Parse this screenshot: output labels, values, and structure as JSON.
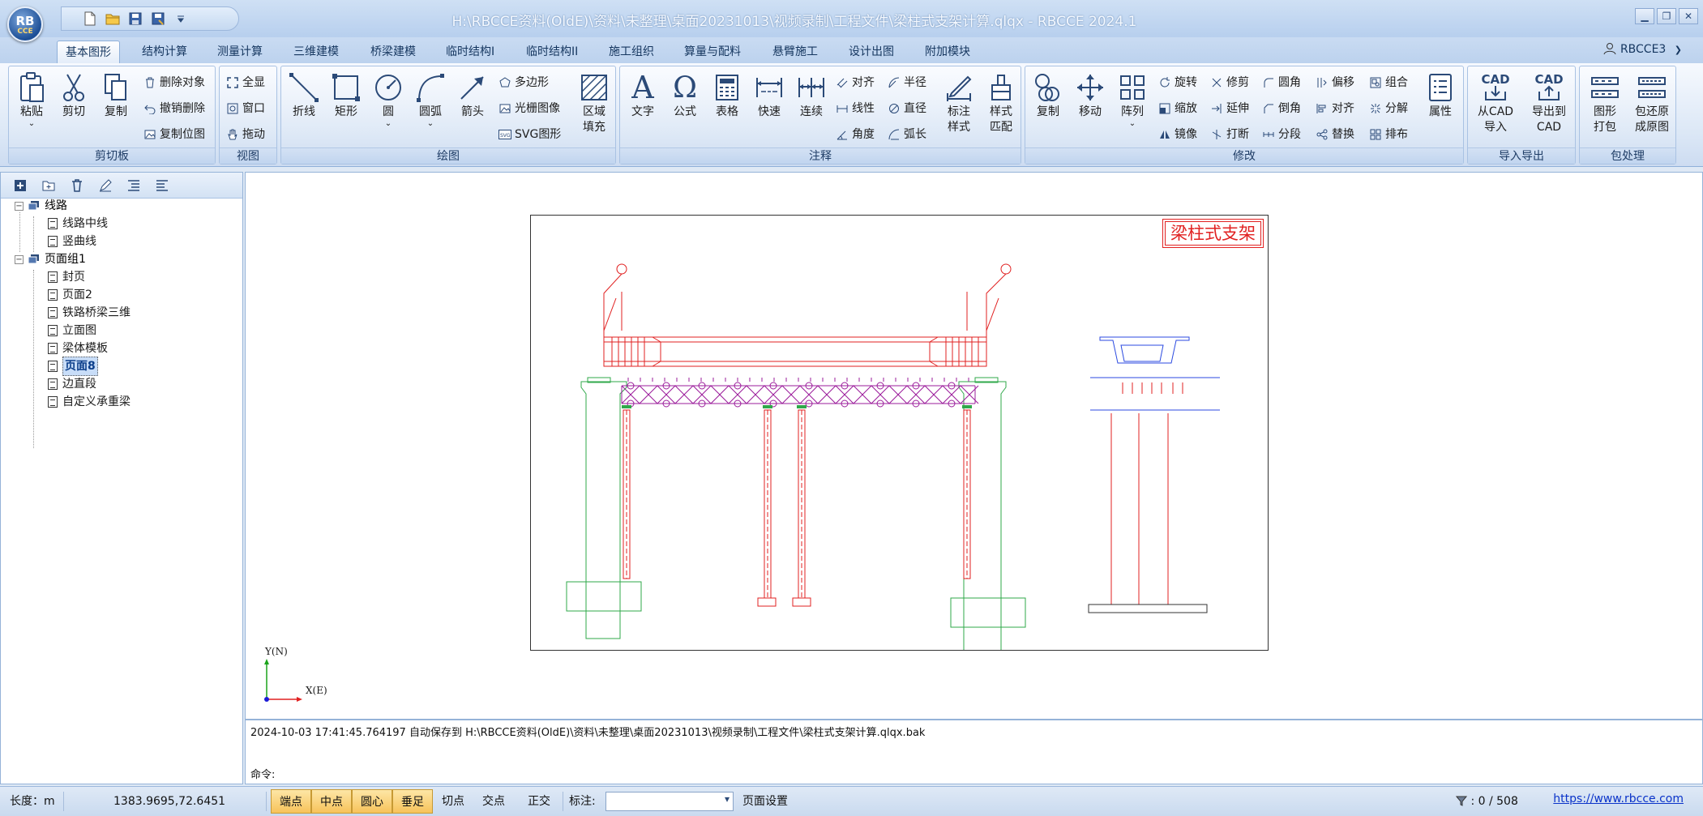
{
  "app": {
    "logo_text": "RB",
    "logo_sub": "CCE",
    "window_title": "H:\\RBCCE资料(OldE)\\资料\\未整理\\桌面20231013\\视频录制\\工程文件\\梁柱式支架计算.qlqx - RBCCE 2024.1",
    "user": "RBCCE3",
    "colors": {
      "accent": "#15365f",
      "drawing_red": "#e12121",
      "drawing_green": "#2fa84a",
      "drawing_purple": "#9b1c9b"
    }
  },
  "tabs": [
    "基本图形",
    "结构计算",
    "测量计算",
    "三维建模",
    "桥梁建模",
    "临时结构I",
    "临时结构II",
    "施工组织",
    "算量与配料",
    "悬臂施工",
    "设计出图",
    "附加模块"
  ],
  "ribbon": {
    "clipboard": {
      "label": "剪切板",
      "paste": "粘贴",
      "cut": "剪切",
      "copy": "复制",
      "delete_obj": "删除对象",
      "undo_delete": "撤销删除",
      "copy_pos": "复制位图"
    },
    "view": {
      "label": "视图",
      "full": "全显",
      "window": "窗口",
      "drag": "拖动"
    },
    "draw": {
      "label": "绘图",
      "polyline": "折线",
      "rect": "矩形",
      "circle": "圆",
      "arc": "圆弧",
      "arrow": "箭头",
      "polygon": "多边形",
      "raster": "光栅图像",
      "svg": "SVG图形",
      "region_fill_1": "区域",
      "region_fill_2": "填充"
    },
    "annot": {
      "label": "注释",
      "text": "文字",
      "formula": "公式",
      "table": "表格",
      "fast": "快速",
      "continuous": "连续",
      "align": "对齐",
      "linear": "线性",
      "angle": "角度",
      "radius": "半径",
      "diameter": "直径",
      "arclen": "弧长",
      "mark_style_1": "标注",
      "mark_style_2": "样式",
      "style_match_1": "样式",
      "style_match_2": "匹配"
    },
    "modify": {
      "label": "修改",
      "copy": "复制",
      "move": "移动",
      "array": "阵列",
      "rotate": "旋转",
      "scale": "缩放",
      "mirror": "镜像",
      "trim": "修剪",
      "extend": "延伸",
      "break": "打断",
      "fillet": "圆角",
      "chamfer": "倒角",
      "segment": "分段",
      "offset": "偏移",
      "align": "对齐",
      "replace": "替换",
      "group": "组合",
      "explode": "分解",
      "arrange": "排布",
      "props": "属性"
    },
    "io": {
      "label": "导入导出",
      "from_cad_1": "从CAD",
      "from_cad_2": "导入",
      "to_cad_1": "导出到",
      "to_cad_2": "CAD",
      "cad_icon": "CAD"
    },
    "pack": {
      "label": "包处理",
      "pack_1": "图形",
      "pack_2": "打包",
      "restore_1": "包还原",
      "restore_2": "成原图"
    }
  },
  "tree": {
    "root1": "线路",
    "root1_children": [
      "线路中线",
      "竖曲线"
    ],
    "root2": "页面组1",
    "root2_children": [
      "封页",
      "页面2",
      "铁路桥梁三维",
      "立面图",
      "梁体模板",
      "页面8",
      "边直段",
      "自定义承重梁"
    ],
    "selected": "页面8"
  },
  "canvas": {
    "sheet_title": "梁柱式支架",
    "axis_y": "Y(N)",
    "axis_x": "X(E)"
  },
  "log": {
    "line": "2024-10-03 17:41:45.764197 自动保存到 H:\\RBCCE资料(OldE)\\资料\\未整理\\桌面20231013\\视频录制\\工程文件\\梁柱式支架计算.qlqx.bak",
    "cmd_label": "命令:"
  },
  "status": {
    "length_label": "长度：m",
    "coords": "1383.9695,72.6451",
    "snaps": [
      {
        "label": "端点",
        "on": true
      },
      {
        "label": "中点",
        "on": true
      },
      {
        "label": "圆心",
        "on": true
      },
      {
        "label": "垂足",
        "on": true
      },
      {
        "label": "切点",
        "on": false
      },
      {
        "label": "交点",
        "on": false
      },
      {
        "label": "正交",
        "on": false
      }
    ],
    "mark_label": "标注:",
    "page_setup": "页面设置",
    "filter_count": ": 0 / 508",
    "website": "https://www.rbcce.com"
  }
}
